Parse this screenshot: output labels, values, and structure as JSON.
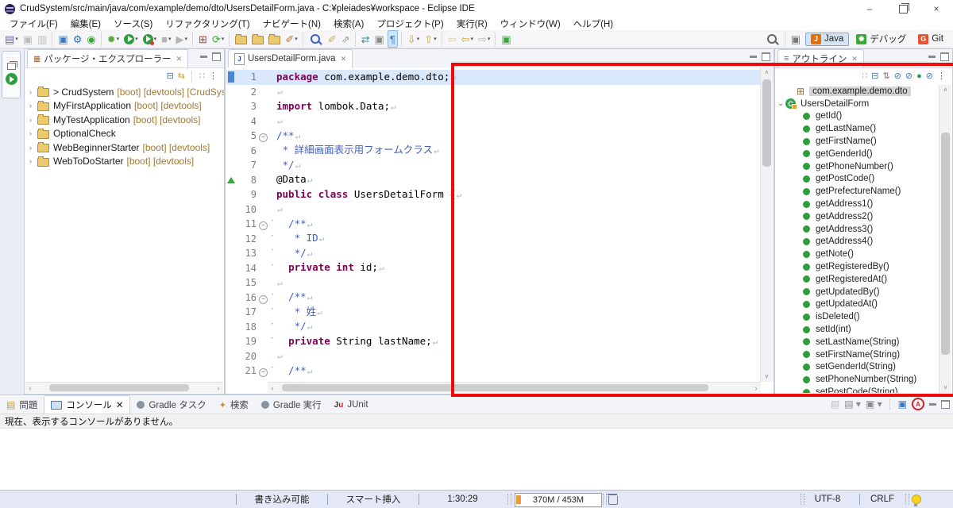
{
  "window": {
    "title": "CrudSystem/src/main/java/com/example/demo/dto/UsersDetailForm.java - C:¥pleiades¥workspace - Eclipse IDE"
  },
  "menu": {
    "items": [
      "ファイル(F)",
      "編集(E)",
      "ソース(S)",
      "リファクタリング(T)",
      "ナビゲート(N)",
      "検索(A)",
      "プロジェクト(P)",
      "実行(R)",
      "ウィンドウ(W)",
      "ヘルプ(H)"
    ]
  },
  "toolbar": {
    "groups": [
      [
        {
          "n": "new-wizard",
          "g": "▤",
          "c": "#6a5fc9",
          "dd": 1
        },
        {
          "n": "save",
          "g": "▣",
          "c": "#bcbcbc"
        },
        {
          "n": "save-all",
          "g": "▥",
          "c": "#bcbcbc"
        }
      ],
      [
        {
          "n": "terminal",
          "g": "▣",
          "c": "#3b78c4"
        },
        {
          "n": "spring-gear",
          "g": "⚙",
          "c": "#2f6fc0"
        },
        {
          "n": "boot-power",
          "g": "◉",
          "c": "#3da639"
        }
      ],
      [
        {
          "n": "debug",
          "g": "✹",
          "c": "#55a839",
          "dd": 1
        },
        {
          "n": "run",
          "type": "play",
          "dd": 1
        },
        {
          "n": "profile",
          "type": "playdot",
          "dd": 1
        },
        {
          "n": "stop",
          "g": "■",
          "c": "#b4b4b4",
          "dd": 1
        },
        {
          "n": "relaunch",
          "g": "▶",
          "c": "#b4b4b4",
          "dd": 1
        }
      ],
      [
        {
          "n": "coverage",
          "g": "⊞",
          "c": "#a1452f"
        },
        {
          "n": "gradle-build",
          "g": "⟳",
          "c": "#3da639",
          "dd": 1
        }
      ],
      [
        {
          "n": "open-type",
          "type": "folder"
        },
        {
          "n": "open-resource",
          "type": "folder"
        },
        {
          "n": "open-file",
          "type": "folder"
        },
        {
          "n": "format-brush",
          "g": "✐",
          "c": "#b87333",
          "dd": 1
        }
      ],
      [
        {
          "n": "plug-search",
          "type": "mag",
          "c": "#3a5fcd"
        },
        {
          "n": "annotate",
          "g": "✐",
          "c": "#d9b23c"
        },
        {
          "n": "external",
          "g": "⇗",
          "c": "#9a9a9a"
        }
      ],
      [
        {
          "n": "link-editor",
          "g": "⇄",
          "c": "#3d8f8f"
        },
        {
          "n": "mark-occurrences",
          "g": "▣",
          "c": "#8a8a8a"
        },
        {
          "n": "show-whitespace",
          "g": "¶",
          "c": "#3b78c4",
          "act": 1
        }
      ],
      [
        {
          "n": "next-annotation",
          "g": "⇩",
          "c": "#c8a838",
          "dd": 1
        },
        {
          "n": "prev-annotation",
          "g": "⇧",
          "c": "#c8a838",
          "dd": 1
        }
      ],
      [
        {
          "n": "last-edit-location",
          "g": "⇦",
          "c": "#d8cfa0"
        },
        {
          "n": "back",
          "g": "⇦",
          "c": "#c8a838",
          "dd": 1
        },
        {
          "n": "forward",
          "g": "⇨",
          "c": "#b8b8b8",
          "dd": 1
        }
      ],
      [
        {
          "n": "new-editor-window",
          "g": "▣",
          "c": "#3da639"
        }
      ]
    ]
  },
  "perspectives": {
    "items": [
      {
        "label": "Java",
        "letter": "J",
        "color": "#e76f00",
        "active": true
      },
      {
        "label": "デバッグ",
        "letter": "✹",
        "color": "#3da639",
        "active": false
      },
      {
        "label": "Git",
        "letter": "G",
        "color": "#e8502e",
        "active": false
      }
    ]
  },
  "package_explorer": {
    "title": "パッケージ・エクスプローラー",
    "projects": [
      {
        "name": "> CrudSystem",
        "dec": "[boot] [devtools] [CrudSystem m"
      },
      {
        "name": "MyFirstApplication",
        "dec": "[boot] [devtools]"
      },
      {
        "name": "MyTestApplication",
        "dec": "[boot] [devtools]"
      },
      {
        "name": "OptionalCheck",
        "dec": ""
      },
      {
        "name": "WebBeginnerStarter",
        "dec": "[boot] [devtools]"
      },
      {
        "name": "WebToDoStarter",
        "dec": "[boot] [devtools]"
      }
    ]
  },
  "editor": {
    "tab": "UsersDetailForm.java",
    "eol_char": "↵",
    "lines": [
      {
        "n": "1",
        "cur": 1,
        "seg": [
          [
            "k",
            "package"
          ],
          [
            "p",
            " com.example.demo.dto;"
          ]
        ]
      },
      {
        "n": "2",
        "seg": []
      },
      {
        "n": "3",
        "seg": [
          [
            "k",
            "import"
          ],
          [
            "p",
            " lombok.Data;"
          ]
        ]
      },
      {
        "n": "4",
        "seg": []
      },
      {
        "n": "5",
        "fold": 1,
        "seg": [
          [
            "c",
            "/**"
          ]
        ]
      },
      {
        "n": "6",
        "seg": [
          [
            "c",
            " * 詳細画面表示用フォームクラス"
          ]
        ]
      },
      {
        "n": "7",
        "seg": [
          [
            "c",
            " */"
          ]
        ]
      },
      {
        "n": "8",
        "mark": 1,
        "seg": [
          [
            "p",
            "@Data"
          ]
        ]
      },
      {
        "n": "9",
        "seg": [
          [
            "k",
            "public"
          ],
          [
            "p",
            " "
          ],
          [
            "k",
            "class"
          ],
          [
            "p",
            " UsersDetailForm {"
          ]
        ]
      },
      {
        "n": "10",
        "seg": []
      },
      {
        "n": "11",
        "fold": 1,
        "car": 1,
        "seg": [
          [
            "c",
            "  /**"
          ]
        ]
      },
      {
        "n": "12",
        "car": 1,
        "seg": [
          [
            "c",
            "   * ID"
          ]
        ]
      },
      {
        "n": "13",
        "car": 1,
        "seg": [
          [
            "c",
            "   */"
          ]
        ]
      },
      {
        "n": "14",
        "car": 1,
        "seg": [
          [
            "p",
            "  "
          ],
          [
            "k",
            "private"
          ],
          [
            "p",
            " "
          ],
          [
            "k",
            "int"
          ],
          [
            "p",
            " id;"
          ]
        ]
      },
      {
        "n": "15",
        "seg": []
      },
      {
        "n": "16",
        "fold": 1,
        "car": 1,
        "seg": [
          [
            "c",
            "  /**"
          ]
        ]
      },
      {
        "n": "17",
        "car": 1,
        "seg": [
          [
            "c",
            "   * 姓"
          ]
        ]
      },
      {
        "n": "18",
        "car": 1,
        "seg": [
          [
            "c",
            "   */"
          ]
        ]
      },
      {
        "n": "19",
        "car": 1,
        "seg": [
          [
            "p",
            "  "
          ],
          [
            "k",
            "private"
          ],
          [
            "p",
            " String lastName;"
          ]
        ]
      },
      {
        "n": "20",
        "seg": []
      },
      {
        "n": "21",
        "fold": 1,
        "car": 1,
        "seg": [
          [
            "c",
            "  /**"
          ]
        ]
      }
    ]
  },
  "outline": {
    "title": "アウトライン",
    "package": "com.example.demo.dto",
    "class": "UsersDetailForm",
    "methods": [
      "getId()",
      "getLastName()",
      "getFirstName()",
      "getGenderId()",
      "getPhoneNumber()",
      "getPostCode()",
      "getPrefectureName()",
      "getAddress1()",
      "getAddress2()",
      "getAddress3()",
      "getAddress4()",
      "getNote()",
      "getRegisteredBy()",
      "getRegisteredAt()",
      "getUpdatedBy()",
      "getUpdatedAt()",
      "isDeleted()",
      "setId(int)",
      "setLastName(String)",
      "setFirstName(String)",
      "setGenderId(String)",
      "setPhoneNumber(String)",
      "setPostCode(String)"
    ]
  },
  "console": {
    "tabs": [
      {
        "label": "問題",
        "icon": "problems"
      },
      {
        "label": "コンソール",
        "icon": "console",
        "active": true,
        "closable": true
      },
      {
        "label": "Gradle タスク",
        "icon": "gradle"
      },
      {
        "label": "検索",
        "icon": "flash"
      },
      {
        "label": "Gradle 実行",
        "icon": "gradle"
      },
      {
        "label": "JUnit",
        "icon": "junit"
      }
    ],
    "message": "現在、表示するコンソールがありません。"
  },
  "statusbar": {
    "writable": "書き込み可能",
    "smart_insert": "スマート挿入",
    "caret_position": "1:30:29",
    "heap": "370M / 453M",
    "encoding": "UTF-8",
    "line_delimiter": "CRLF"
  }
}
